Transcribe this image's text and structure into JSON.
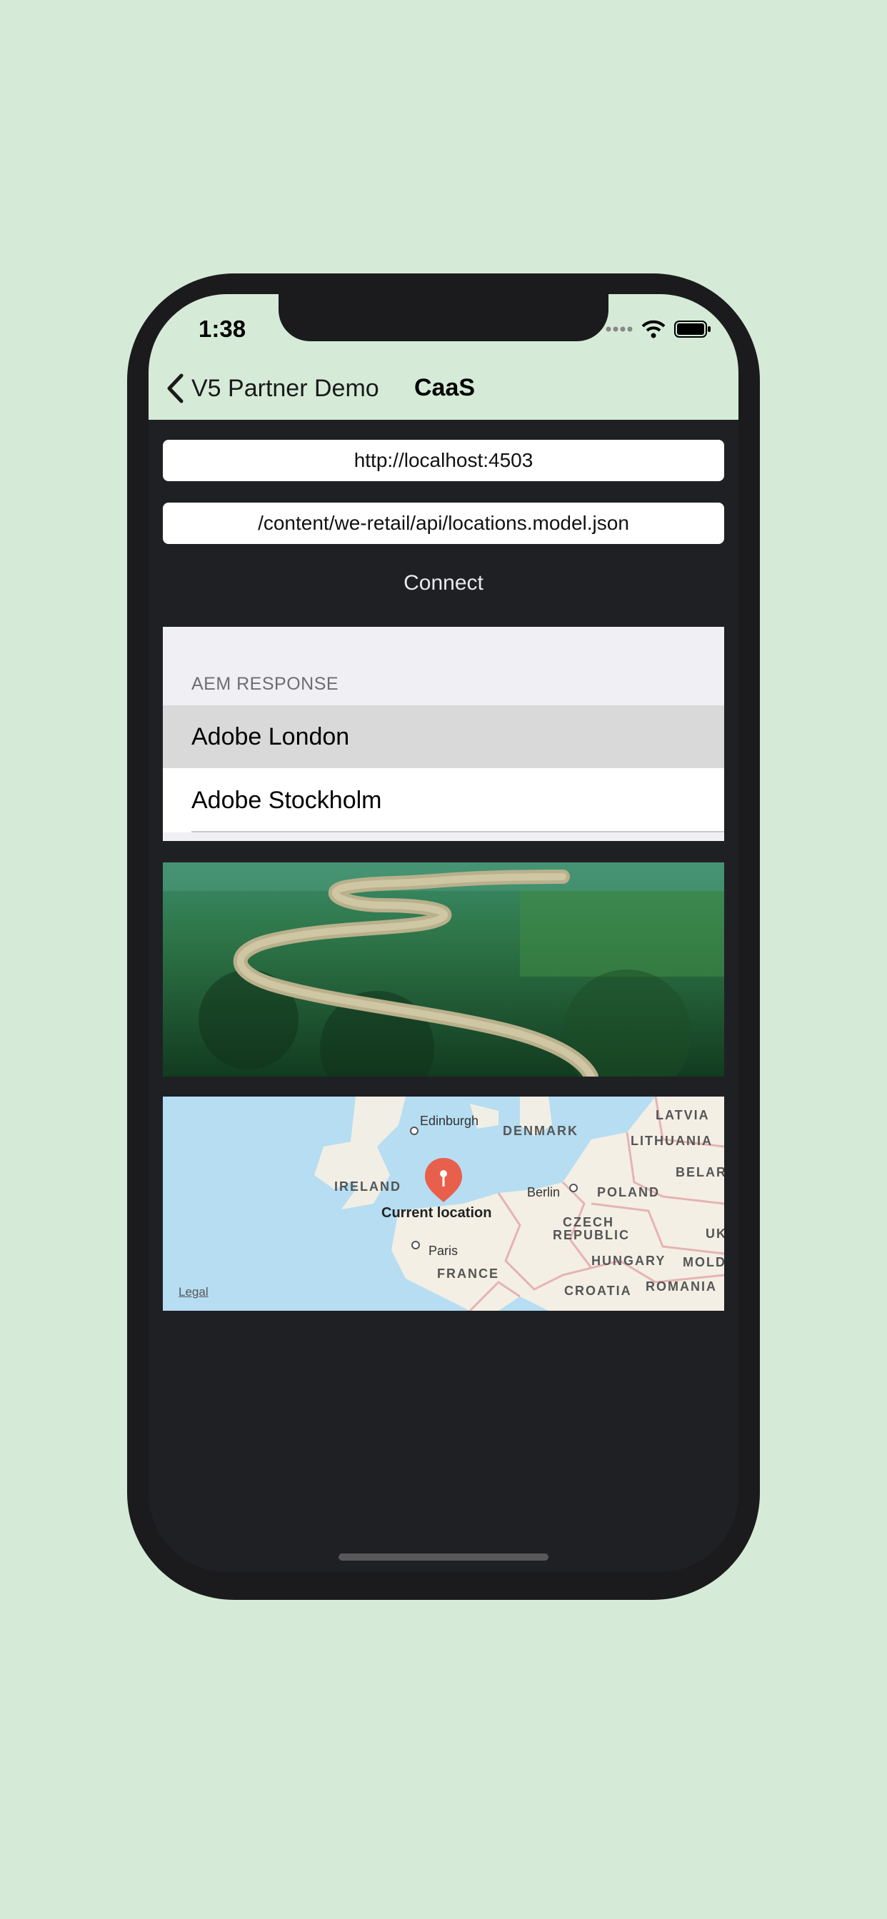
{
  "status": {
    "time": "1:38"
  },
  "nav": {
    "back_label": "V5 Partner Demo",
    "title": "CaaS"
  },
  "form": {
    "host_value": "http://localhost:4503",
    "path_value": "/content/we-retail/api/locations.model.json",
    "connect_label": "Connect"
  },
  "response": {
    "header": "AEM RESPONSE",
    "items": [
      {
        "label": "Adobe London"
      },
      {
        "label": "Adobe Stockholm"
      }
    ]
  },
  "map": {
    "labels": {
      "edinburgh": "Edinburgh",
      "denmark": "DENMARK",
      "latvia": "LATVIA",
      "lithuania": "LITHUANIA",
      "ireland": "IRELAND",
      "berlin": "Berlin",
      "poland": "POLAND",
      "belarus": "BELAR",
      "current_location": "Current location",
      "czech": "CZECH",
      "republic": "REPUBLIC",
      "paris": "Paris",
      "uk": "UK",
      "hungary": "HUNGARY",
      "moldova": "MOLD",
      "france": "FRANCE",
      "croatia": "CROATIA",
      "romania": "ROMANIA",
      "legal": "Legal"
    }
  },
  "colors": {
    "background": "#d5ebd7",
    "content": "#1f2024",
    "pin": "#e8604c"
  }
}
